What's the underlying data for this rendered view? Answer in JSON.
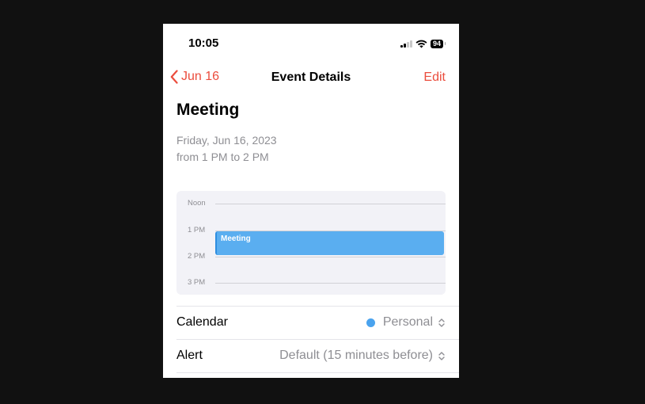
{
  "status_bar": {
    "time": "10:05",
    "battery": "94"
  },
  "nav": {
    "back_label": "Jun 16",
    "title": "Event Details",
    "edit_label": "Edit"
  },
  "event": {
    "title": "Meeting",
    "date": "Friday, Jun 16, 2023",
    "time": "from 1 PM to 2 PM"
  },
  "timeline": {
    "hours": [
      "Noon",
      "1 PM",
      "2 PM",
      "3 PM"
    ],
    "event_label": "Meeting"
  },
  "details": {
    "calendar": {
      "label": "Calendar",
      "value": "Personal",
      "color": "#4aa3ee"
    },
    "alert": {
      "label": "Alert",
      "value": "Default (15 minutes before)"
    }
  },
  "colors": {
    "accent": "#eb4d3d",
    "event_fill": "#5aaef0"
  },
  "icons": [
    "chevron-left-icon",
    "signal-icon",
    "wifi-icon",
    "battery-icon",
    "chevron-updown-icon"
  ]
}
